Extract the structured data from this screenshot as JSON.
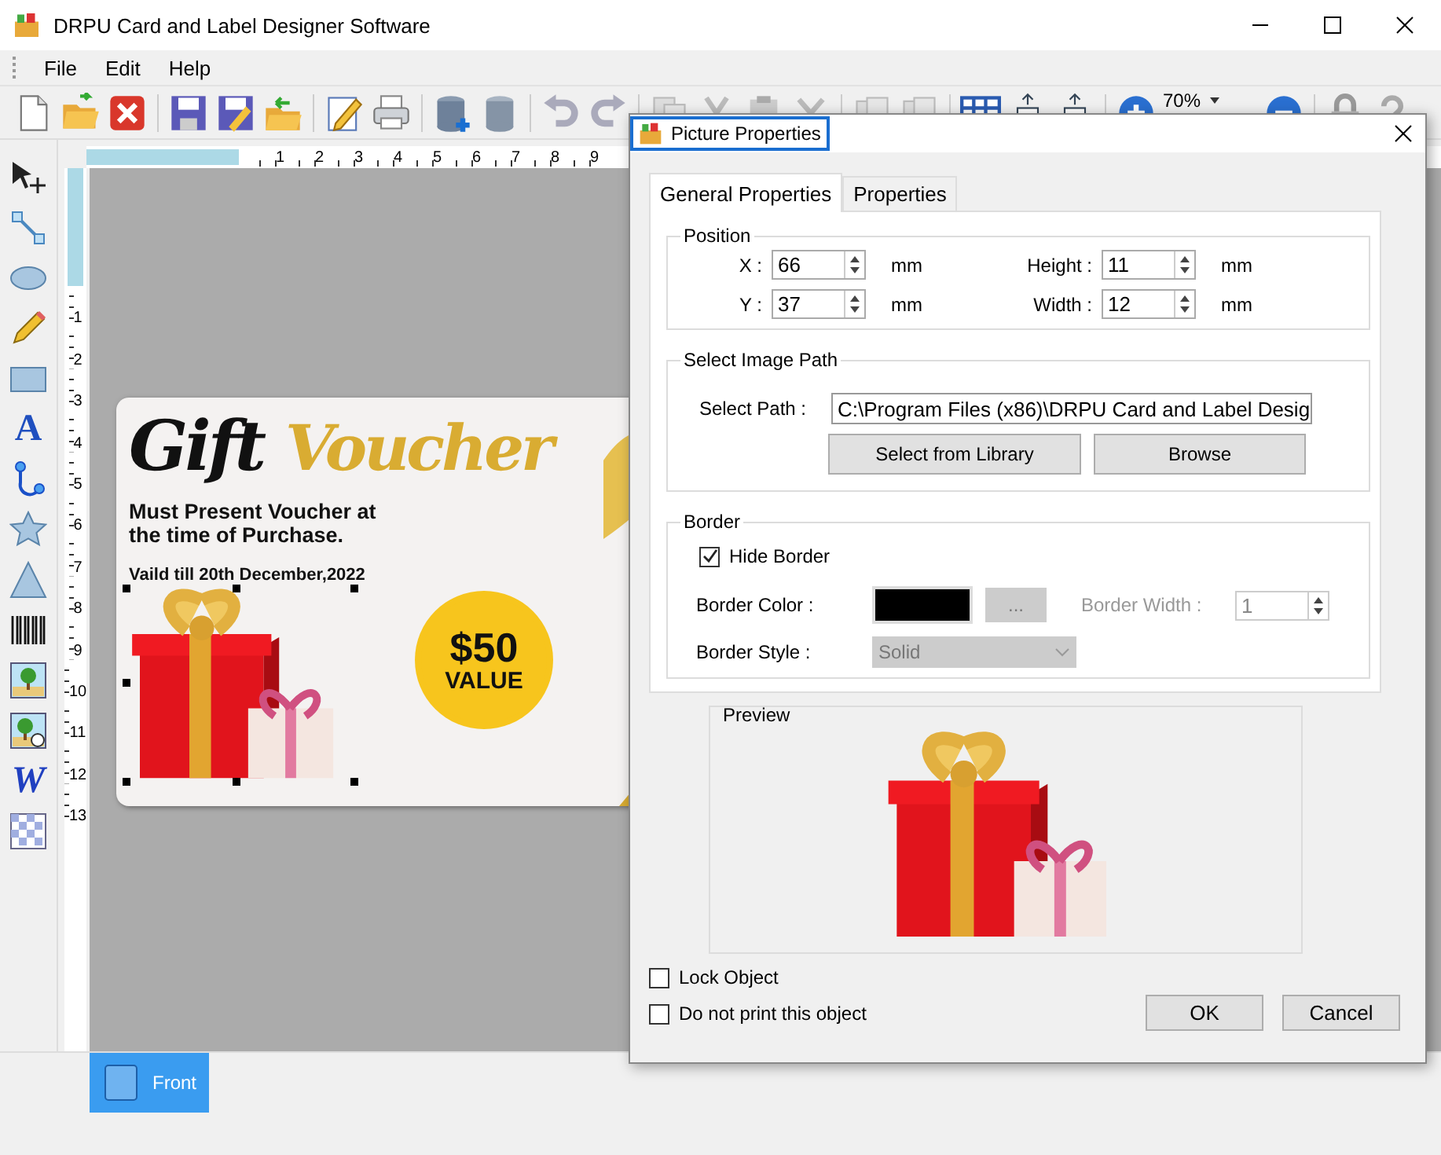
{
  "window": {
    "title": "DRPU Card and Label Designer Software"
  },
  "menu": [
    {
      "label": "File"
    },
    {
      "label": "Edit"
    },
    {
      "label": "Help"
    }
  ],
  "toolbar": {
    "zoom": "70%"
  },
  "toolbox": [
    {
      "kind": "pointer"
    },
    {
      "kind": "line"
    },
    {
      "kind": "ellipse"
    },
    {
      "kind": "pencil"
    },
    {
      "kind": "rectangle"
    },
    {
      "kind": "text",
      "glyph": "A"
    },
    {
      "kind": "curve"
    },
    {
      "kind": "star"
    },
    {
      "kind": "triangle"
    },
    {
      "kind": "barcode"
    },
    {
      "kind": "picture"
    },
    {
      "kind": "picture-library"
    },
    {
      "kind": "wordart",
      "glyph": "W"
    },
    {
      "kind": "pattern"
    }
  ],
  "rulers": {
    "horizontal": [
      "1",
      "2",
      "3",
      "4",
      "5",
      "6",
      "7",
      "8",
      "9"
    ],
    "vertical": [
      "1",
      "2",
      "3",
      "4",
      "5",
      "6",
      "7",
      "8",
      "9",
      "10",
      "11",
      "12",
      "13"
    ]
  },
  "card": {
    "title_dark": "Gift",
    "title_gold": "Voucher",
    "note": "Must Present Voucher at the time of Purchase.",
    "validity": "Vaild till 20th December,2022",
    "badge_amount": "$50",
    "badge_label": "VALUE"
  },
  "page_tabs": [
    {
      "label": "Front",
      "selected": true
    }
  ],
  "dialog": {
    "title": "Picture Properties",
    "tabs": [
      {
        "label": "General Properties",
        "selected": true
      },
      {
        "label": "Properties",
        "selected": false
      }
    ],
    "position": {
      "legend": "Position",
      "fields": [
        {
          "label": "X :",
          "value": "66",
          "unit": "mm"
        },
        {
          "label": "Height :",
          "value": "11",
          "unit": "mm"
        },
        {
          "label": "Y :",
          "value": "37",
          "unit": "mm"
        },
        {
          "label": "Width :",
          "value": "12",
          "unit": "mm"
        }
      ]
    },
    "image_path": {
      "legend": "Select Image Path",
      "label": "Select Path :",
      "value": "C:\\Program Files (x86)\\DRPU Card and Label Desig",
      "buttons": [
        "Select from Library",
        "Browse"
      ]
    },
    "border": {
      "legend": "Border",
      "hide_border": {
        "label": "Hide Border",
        "checked": true
      },
      "color": {
        "label": "Border Color :",
        "color": "#000000",
        "button": "...",
        "disabled": true
      },
      "width": {
        "label": "Border Width :",
        "value": "1",
        "disabled": true
      },
      "style": {
        "label": "Border Style :",
        "value": "Solid",
        "disabled": true
      }
    },
    "preview": {
      "legend": "Preview"
    },
    "options": [
      {
        "label": "Lock Object",
        "checked": false
      },
      {
        "label": "Do not print this object",
        "checked": false
      }
    ],
    "buttons": [
      "OK",
      "Cancel"
    ]
  }
}
